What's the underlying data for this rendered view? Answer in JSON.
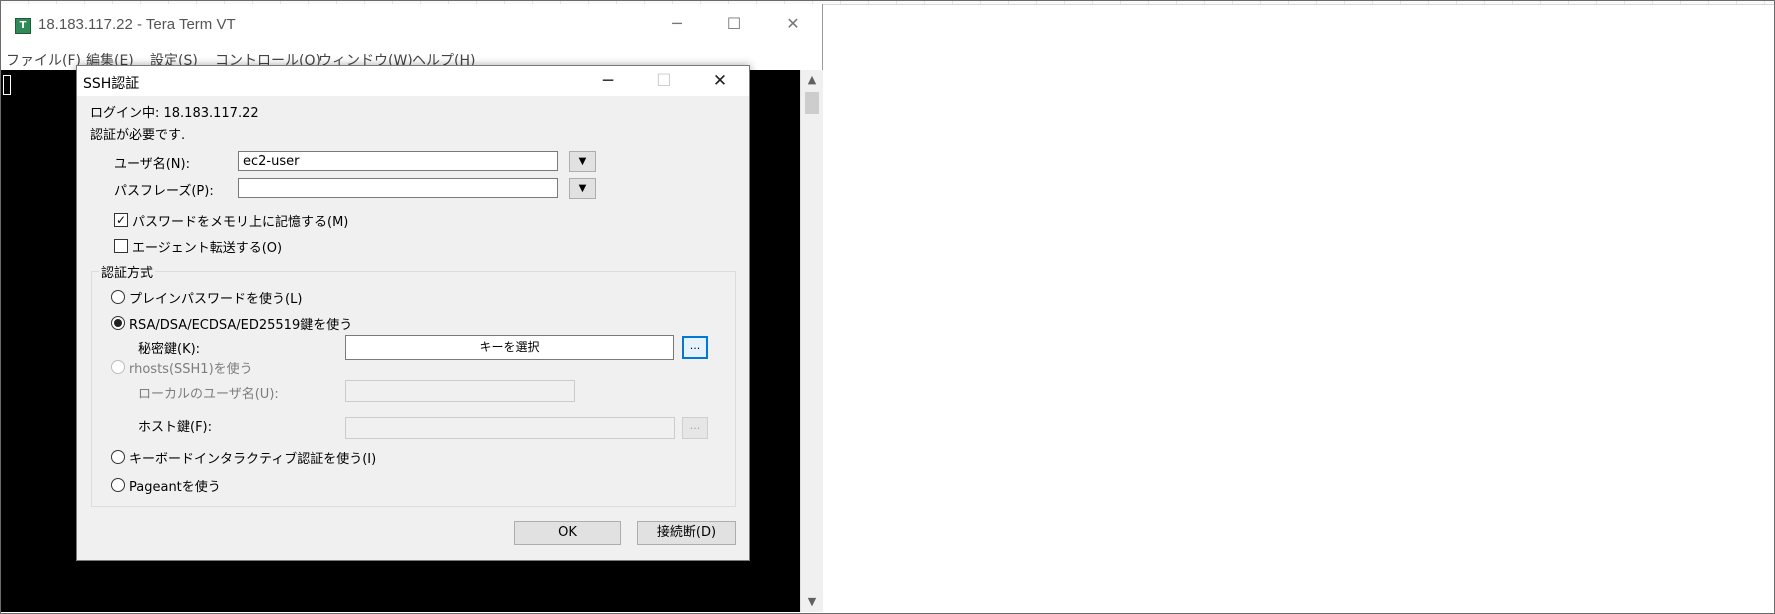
{
  "window": {
    "title": "18.183.117.22 - Tera Term VT",
    "app_icon": "T",
    "minimize": "─",
    "maximize": "☐",
    "close": "✕"
  },
  "menu": [
    {
      "label": "ファイル(F)"
    },
    {
      "label": "編集(E)"
    },
    {
      "label": "設定(S)"
    },
    {
      "label": "コントロール(O)"
    },
    {
      "label": "ウィンドウ(W)"
    },
    {
      "label": "ヘルプ(H)"
    }
  ],
  "scrollbar": {
    "up": "▲",
    "down": "▼"
  },
  "dialog": {
    "title": "SSH認証",
    "minimize": "─",
    "maximize": "☐",
    "close": "✕",
    "logging_in": "ログイン中: 18.183.117.22",
    "auth_required": "認証が必要です.",
    "username_label": "ユーザ名(N):",
    "username_value": "ec2-user",
    "passphrase_label": "パスフレーズ(P):",
    "passphrase_value": "",
    "dropdown_glyph": "▼",
    "remember_password": {
      "label": "パスワードをメモリ上に記憶する(M)",
      "checked": true,
      "mark": "✓"
    },
    "agent_forward": {
      "label": "エージェント転送する(O)",
      "checked": false
    },
    "auth_method_group": "認証方式",
    "methods": {
      "plain": "プレインパスワードを使う(L)",
      "rsa": "RSA/DSA/ECDSA/ED25519鍵を使う",
      "rhosts": "rhosts(SSH1)を使う",
      "keyboard": "キーボードインタラクティブ認証を使う(I)",
      "pageant": "Pageantを使う"
    },
    "selected_method": "rsa",
    "private_key_label": "秘密鍵(K):",
    "private_key_button": "キーを選択",
    "browse_button": "...",
    "local_user_label": "ローカルのユーザ名(U):",
    "host_key_label": "ホスト鍵(F):",
    "ok_button": "OK",
    "disconnect_button": "接続断(D)"
  }
}
